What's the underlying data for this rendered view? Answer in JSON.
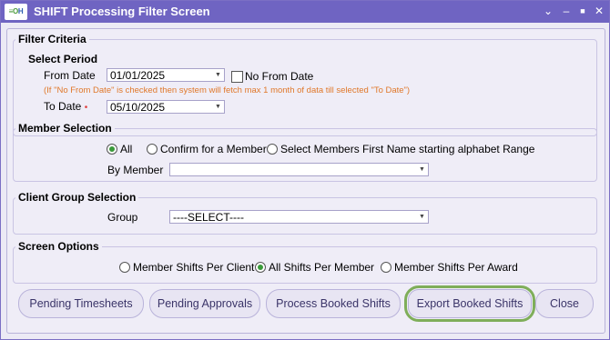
{
  "window": {
    "title": "SHIFT Processing Filter Screen",
    "logo_text_1": "≡O",
    "logo_text_2": "H",
    "controls": {
      "menu": "⌄",
      "minimize": "–",
      "maximize": "■",
      "close": "✕"
    }
  },
  "filter": {
    "legend": "Filter Criteria",
    "select_period": {
      "heading": "Select Period",
      "from_label": "From Date",
      "from_value": "01/01/2025",
      "no_from_label": "No From Date",
      "no_from_checked": false,
      "note": "(If \"No From Date\" is checked then system will fetch max 1 month of data till selected \"To Date\")",
      "to_label": "To Date",
      "to_required": "•",
      "to_value": "05/10/2025"
    },
    "member": {
      "legend": "Member Selection",
      "options": [
        "All",
        "Confirm for a Member",
        "Select Members First Name starting alphabet Range"
      ],
      "selected": "All",
      "by_member_label": "By Member",
      "by_member_value": ""
    },
    "client_group": {
      "legend": "Client Group Selection",
      "group_label": "Group",
      "group_value": "----SELECT----"
    },
    "screen_options": {
      "legend": "Screen Options",
      "options": [
        "Member Shifts Per Client",
        "All Shifts Per Member",
        "Member Shifts Per Award"
      ],
      "selected": "All Shifts Per Member"
    }
  },
  "buttons": {
    "pending_timesheets": "Pending Timesheets",
    "pending_approvals": "Pending Approvals",
    "process_booked": "Process Booked Shifts",
    "export_booked": "Export Booked Shifts",
    "close": "Close"
  },
  "colors": {
    "titlebar": "#6f64c2",
    "note": "#e0782a",
    "highlight": "#7fae5a"
  }
}
